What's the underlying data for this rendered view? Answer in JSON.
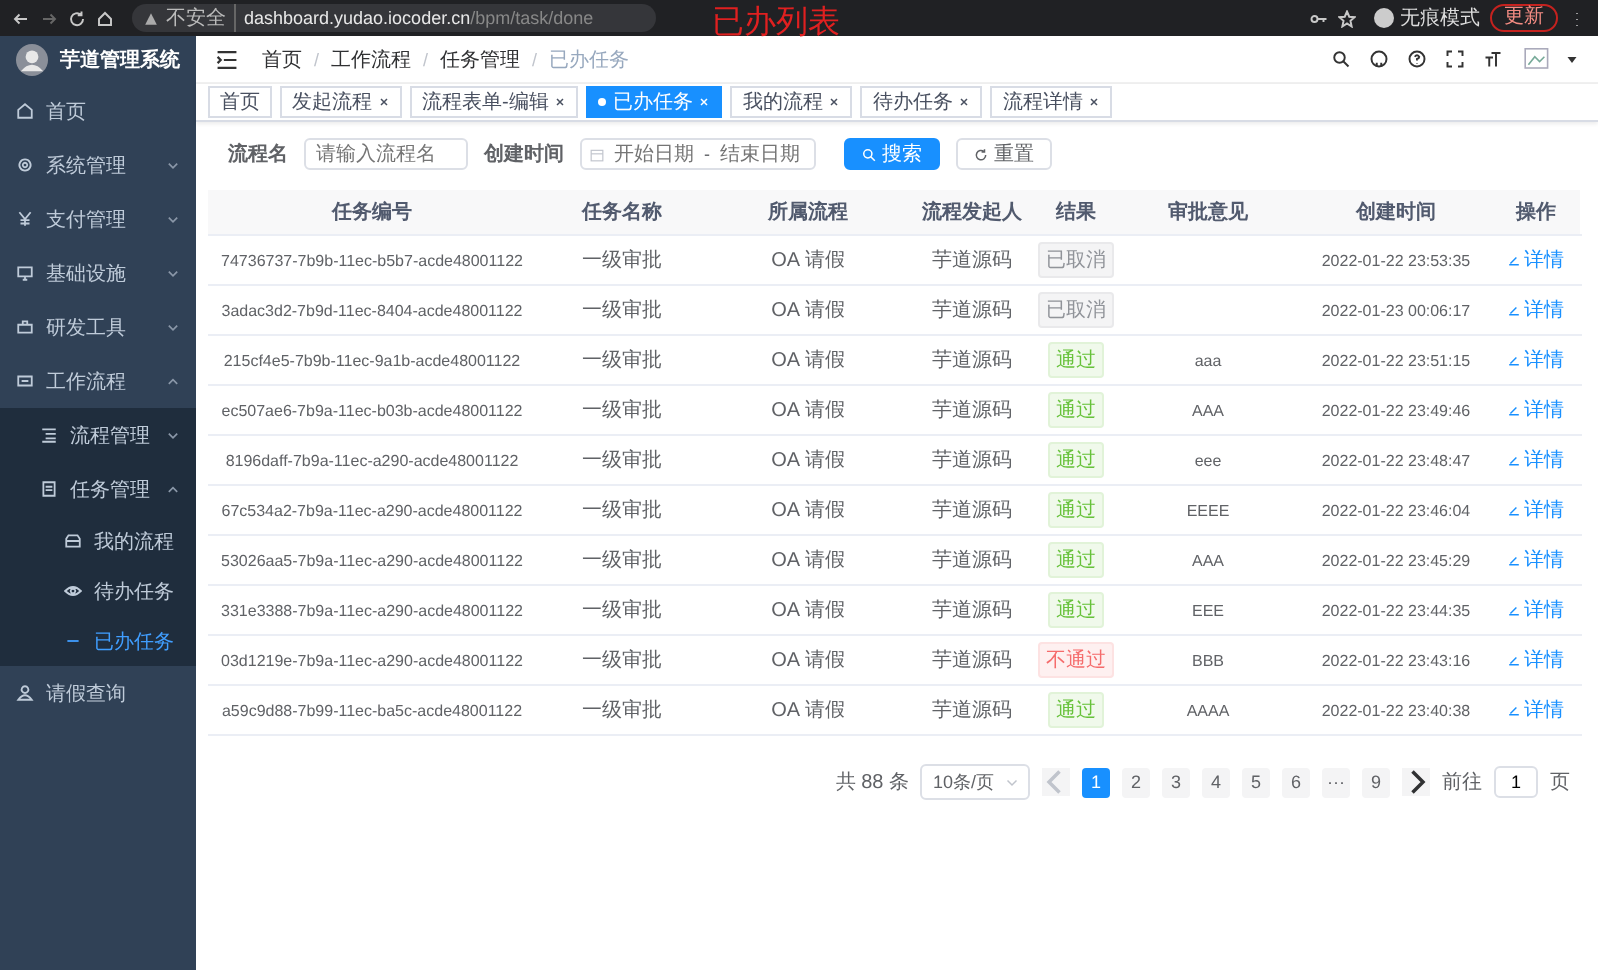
{
  "browser": {
    "security": "不安全",
    "url_host": "dashboard.yudao.iocoder.cn",
    "url_path": "/bpm/task/done",
    "profile": "无痕模式",
    "update_button": "更新"
  },
  "annotation": "已办列表",
  "sidebar": {
    "title": "芋道管理系统",
    "items": [
      {
        "label": "首页",
        "selected": false
      },
      {
        "label": "系统管理",
        "selected": false,
        "expanded": false
      },
      {
        "label": "支付管理",
        "selected": false,
        "expanded": false
      },
      {
        "label": "基础设施",
        "selected": false,
        "expanded": false
      },
      {
        "label": "研发工具",
        "selected": false,
        "expanded": false
      },
      {
        "label": "工作流程",
        "selected": false,
        "expanded": true,
        "children": [
          {
            "label": "流程管理",
            "selected": false,
            "expanded": false
          },
          {
            "label": "任务管理",
            "selected": false,
            "expanded": true,
            "children": [
              {
                "label": "我的流程",
                "selected": false
              },
              {
                "label": "待办任务",
                "selected": false
              },
              {
                "label": "已办任务",
                "selected": true
              }
            ]
          }
        ]
      },
      {
        "label": "请假查询",
        "selected": false
      }
    ]
  },
  "breadcrumb": {
    "separator": "/",
    "items": [
      "首页",
      "工作流程",
      "任务管理",
      "已办任务"
    ]
  },
  "tags": [
    {
      "label": "首页",
      "selected": false,
      "closable": false
    },
    {
      "label": "发起流程",
      "selected": false,
      "closable": true
    },
    {
      "label": "流程表单-编辑",
      "selected": false,
      "closable": true
    },
    {
      "label": "已办任务",
      "selected": true,
      "closable": true
    },
    {
      "label": "我的流程",
      "selected": false,
      "closable": true
    },
    {
      "label": "待办任务",
      "selected": false,
      "closable": true
    },
    {
      "label": "流程详情",
      "selected": false,
      "closable": true
    }
  ],
  "filter": {
    "name_label": "流程名",
    "name_placeholder": "请输入流程名",
    "time_label": "创建时间",
    "start_placeholder": "开始日期",
    "range_separator": "-",
    "end_placeholder": "结束日期",
    "search_button": "搜索",
    "reset_button": "重置"
  },
  "table": {
    "columns": [
      "任务编号",
      "任务名称",
      "所属流程",
      "流程发起人",
      "结果",
      "审批意见",
      "创建时间",
      "操作"
    ],
    "rows": [
      {
        "id": "74736737-7b9b-11ec-b5b7-acde48001122",
        "name": "一级审批",
        "process": "OA 请假",
        "initiator": "芋道源码",
        "result": {
          "label": "已取消",
          "kind": "cancelled"
        },
        "time": "2022-01-22 23:53:35",
        "action": "详情"
      },
      {
        "id": "3adac3d2-7b9d-11ec-8404-acde48001122",
        "name": "一级审批",
        "process": "OA 请假",
        "initiator": "芋道源码",
        "result": {
          "label": "已取消",
          "kind": "cancelled"
        },
        "time": "2022-01-23 00:06:17",
        "action": "详情"
      },
      {
        "id": "215cf4e5-7b9b-11ec-9a1b-acde48001122",
        "name": "一级审批",
        "process": "OA 请假",
        "initiator": "芋道源码",
        "result": {
          "label": "通过",
          "kind": "passed"
        },
        "opinion": "aaa",
        "time": "2022-01-22 23:51:15",
        "action": "详情"
      },
      {
        "id": "ec507ae6-7b9a-11ec-b03b-acde48001122",
        "name": "一级审批",
        "process": "OA 请假",
        "initiator": "芋道源码",
        "result": {
          "label": "通过",
          "kind": "passed"
        },
        "opinion": "AAA",
        "time": "2022-01-22 23:49:46",
        "action": "详情"
      },
      {
        "id": "8196daff-7b9a-11ec-a290-acde48001122",
        "name": "一级审批",
        "process": "OA 请假",
        "initiator": "芋道源码",
        "result": {
          "label": "通过",
          "kind": "passed"
        },
        "opinion": "eee",
        "time": "2022-01-22 23:48:47",
        "action": "详情"
      },
      {
        "id": "67c534a2-7b9a-11ec-a290-acde48001122",
        "name": "一级审批",
        "process": "OA 请假",
        "initiator": "芋道源码",
        "result": {
          "label": "通过",
          "kind": "passed"
        },
        "opinion": "EEEE",
        "time": "2022-01-22 23:46:04",
        "action": "详情"
      },
      {
        "id": "53026aa5-7b9a-11ec-a290-acde48001122",
        "name": "一级审批",
        "process": "OA 请假",
        "initiator": "芋道源码",
        "result": {
          "label": "通过",
          "kind": "passed"
        },
        "opinion": "AAA",
        "time": "2022-01-22 23:45:29",
        "action": "详情"
      },
      {
        "id": "331e3388-7b9a-11ec-a290-acde48001122",
        "name": "一级审批",
        "process": "OA 请假",
        "initiator": "芋道源码",
        "result": {
          "label": "通过",
          "kind": "passed"
        },
        "opinion": "EEE",
        "time": "2022-01-22 23:44:35",
        "action": "详情"
      },
      {
        "id": "03d1219e-7b9a-11ec-a290-acde48001122",
        "name": "一级审批",
        "process": "OA 请假",
        "initiator": "芋道源码",
        "result": {
          "label": "不通过",
          "kind": "rejected"
        },
        "opinion": "BBB",
        "time": "2022-01-22 23:43:16",
        "action": "详情"
      },
      {
        "id": "a59c9d88-7b99-11ec-ba5c-acde48001122",
        "name": "一级审批",
        "process": "OA 请假",
        "initiator": "芋道源码",
        "result": {
          "label": "通过",
          "kind": "passed"
        },
        "opinion": "AAAA",
        "time": "2022-01-22 23:40:38",
        "action": "详情"
      }
    ]
  },
  "pagination": {
    "total": "共 88 条",
    "page_size": "10条/页",
    "pages": [
      {
        "label": "1",
        "selected": true
      },
      {
        "label": "2",
        "selected": false
      },
      {
        "label": "3",
        "selected": false
      },
      {
        "label": "4",
        "selected": false
      },
      {
        "label": "5",
        "selected": false
      },
      {
        "label": "6",
        "selected": false
      },
      {
        "label": "···",
        "selected": false
      },
      {
        "label": "9",
        "selected": false
      }
    ],
    "jump_label": "前往",
    "jump_value": "1",
    "jump_unit": "页"
  }
}
